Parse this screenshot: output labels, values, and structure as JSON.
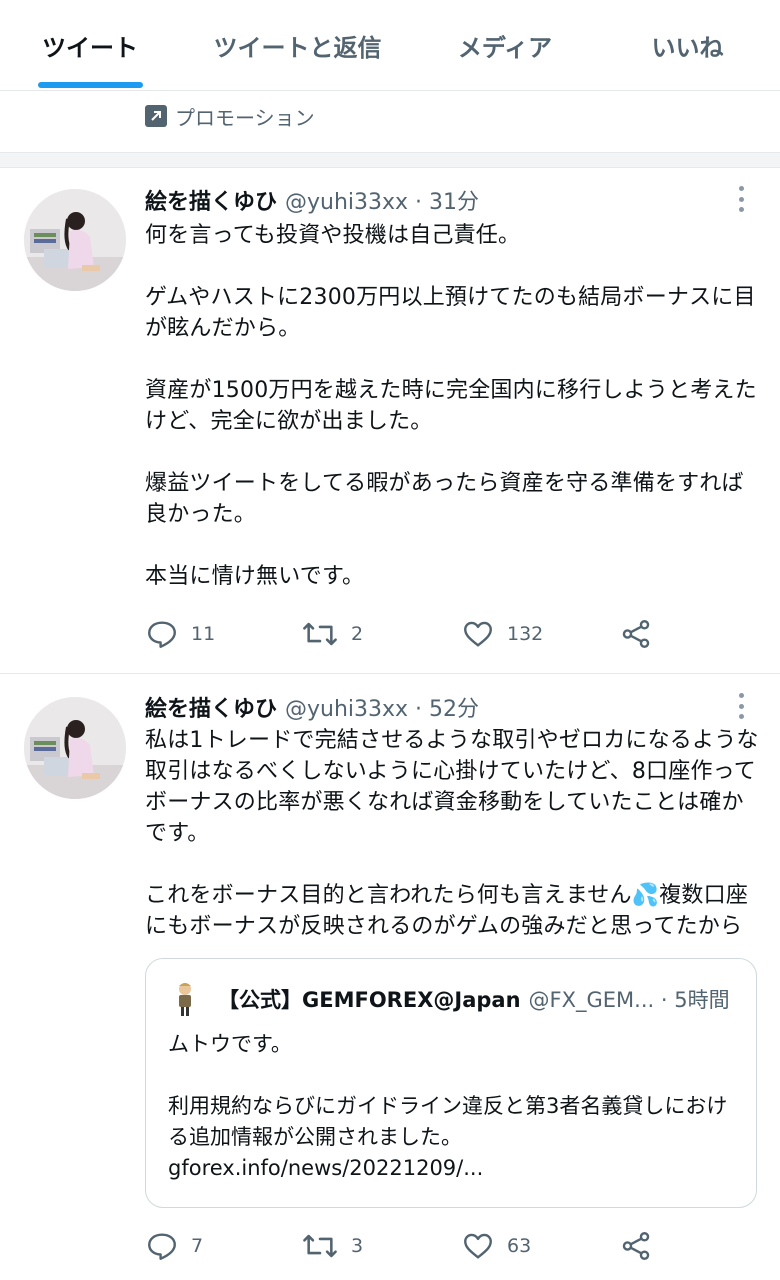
{
  "tabs": [
    {
      "label": "ツイート",
      "active": true
    },
    {
      "label": "ツイートと返信",
      "active": false
    },
    {
      "label": "メディア",
      "active": false
    },
    {
      "label": "いいね",
      "active": false
    }
  ],
  "promotion": {
    "label": "プロモーション",
    "icon": "arrow-up-right-icon"
  },
  "tweets": [
    {
      "author": "絵を描くゆひ",
      "handle": "@yuhi33xx · 31分",
      "text": "何を言っても投資や投機は自己責任。\n\nゲムやハストに2300万円以上預けてたのも結局ボーナスに目が眩んだから。\n\n資産が1500万円を越えた時に完全国内に移行しようと考えたけど、完全に欲が出ました。\n\n爆益ツイートをしてる暇があったら資産を守る準備をすれば良かった。\n\n本当に情け無いです。",
      "replies": "11",
      "retweets": "2",
      "likes": "132"
    },
    {
      "author": "絵を描くゆひ",
      "handle": "@yuhi33xx · 52分",
      "text": "私は1トレードで完結させるような取引やゼロカになるような取引はなるべくしないように心掛けていたけど、8口座作ってボーナスの比率が悪くなれば資金移動をしていたことは確かです。\n\nこれをボーナス目的と言われたら何も言えません💦複数口座にもボーナスが反映されるのがゲムの強みだと思ってたから",
      "quote": {
        "name": "【公式】GEMFOREX@Japan",
        "handle": "@FX_GEM... · 5時間",
        "text": "ムトウです。\n\n利用規約ならびにガイドライン違反と第3者名義貸しにおける追加情報が公開されました。\ngforex.info/news/20221209/..."
      },
      "replies": "7",
      "retweets": "3",
      "likes": "63"
    }
  ],
  "colors": {
    "accent": "#1d9bf0",
    "text": "#0f1419",
    "secondary": "#536471",
    "border": "#e6e9ec"
  }
}
